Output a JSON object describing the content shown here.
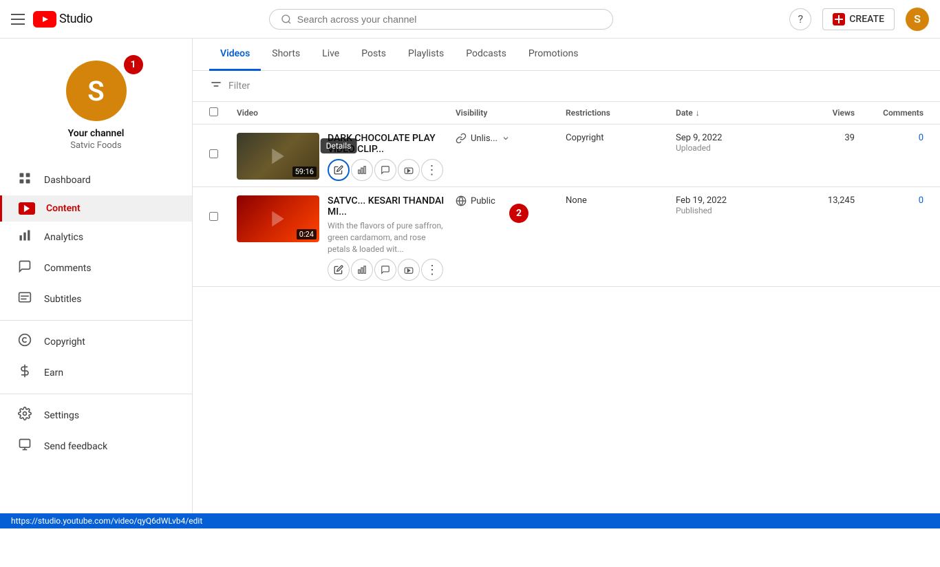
{
  "header": {
    "search_placeholder": "Search across your channel",
    "create_label": "CREATE",
    "help_icon": "?",
    "avatar_letter": "S"
  },
  "sidebar": {
    "channel_name": "Your channel",
    "channel_sub": "Satvic Foods",
    "avatar_letter": "S",
    "nav_items": [
      {
        "id": "dashboard",
        "label": "Dashboard",
        "icon": "grid"
      },
      {
        "id": "content",
        "label": "Content",
        "icon": "play",
        "active": true
      },
      {
        "id": "analytics",
        "label": "Analytics",
        "icon": "bar"
      },
      {
        "id": "comments",
        "label": "Comments",
        "icon": "comment"
      },
      {
        "id": "subtitles",
        "label": "Subtitles",
        "icon": "subtitle"
      },
      {
        "id": "copyright",
        "label": "Copyright",
        "icon": "copyright"
      },
      {
        "id": "earn",
        "label": "Earn",
        "icon": "dollar"
      }
    ],
    "bottom_items": [
      {
        "id": "settings",
        "label": "Settings",
        "icon": "gear"
      },
      {
        "id": "feedback",
        "label": "Send feedback",
        "icon": "feedback"
      }
    ]
  },
  "content": {
    "tabs": [
      {
        "id": "videos",
        "label": "Videos",
        "active": true
      },
      {
        "id": "shorts",
        "label": "Shorts"
      },
      {
        "id": "live",
        "label": "Live"
      },
      {
        "id": "posts",
        "label": "Posts"
      },
      {
        "id": "playlists",
        "label": "Playlists"
      },
      {
        "id": "podcasts",
        "label": "Podcasts"
      },
      {
        "id": "promotions",
        "label": "Promotions"
      }
    ],
    "filter_placeholder": "Filter",
    "table_headers": {
      "video": "Video",
      "visibility": "Visibility",
      "restrictions": "Restrictions",
      "date": "Date",
      "views": "Views",
      "comments": "Comments"
    },
    "rows": [
      {
        "id": "row1",
        "title": "DARK CHOCOLATE PLAY VIDEO CLIP...",
        "description": "",
        "duration": "59:16",
        "visibility": "Unlis...",
        "visibility_type": "unlisted",
        "restrictions": "Copyright",
        "date": "Sep 9, 2022",
        "date_status": "Uploaded",
        "views": "39",
        "comments": "0",
        "thumb_class": "thumb1"
      },
      {
        "id": "row2",
        "title": "SATVC... KESARI THANDAI MI...",
        "description": "With the flavors of pure saffron, green cardamom, and rose petals & loaded wit...",
        "duration": "0:24",
        "visibility": "Public",
        "visibility_type": "public",
        "restrictions": "None",
        "date": "Feb 19, 2022",
        "date_status": "Published",
        "views": "13,245",
        "comments": "0",
        "thumb_class": "thumb2"
      }
    ]
  },
  "tooltip": {
    "details": "Details"
  },
  "status_bar": {
    "url": "https://studio.youtube.com/video/qyQ6dWLvb4/edit"
  },
  "steps": {
    "step1": "1",
    "step2": "2"
  }
}
